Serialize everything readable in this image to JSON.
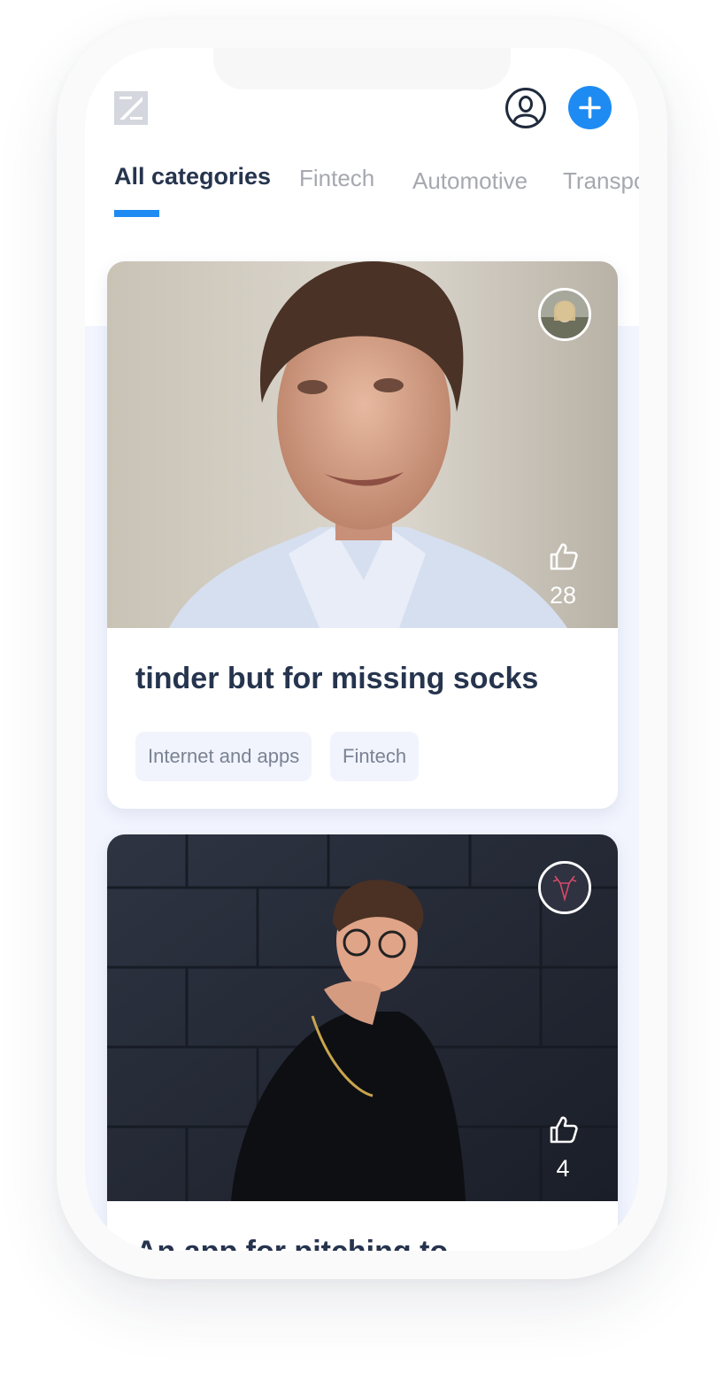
{
  "header": {
    "icons": {
      "logo": "app-logo",
      "profile": "user-icon",
      "add": "plus-icon"
    }
  },
  "tabs": [
    {
      "label": "All categories",
      "active": true
    },
    {
      "label": "Fintech",
      "active": false
    },
    {
      "label": "Automotive",
      "active": false
    },
    {
      "label": "Transpo",
      "active": false
    }
  ],
  "cards": [
    {
      "title": "tinder but for missing socks",
      "likes": "28",
      "tags": [
        "Internet and apps",
        "Fintech"
      ]
    },
    {
      "title": "An app for pitching to",
      "likes": "4",
      "tags": []
    }
  ],
  "colors": {
    "accent": "#1e8bf3",
    "text_dark": "#26344e",
    "text_muted": "#a6a8b0",
    "tag_bg": "#f1f4fc",
    "screen_bg": "#f2f5fe"
  }
}
